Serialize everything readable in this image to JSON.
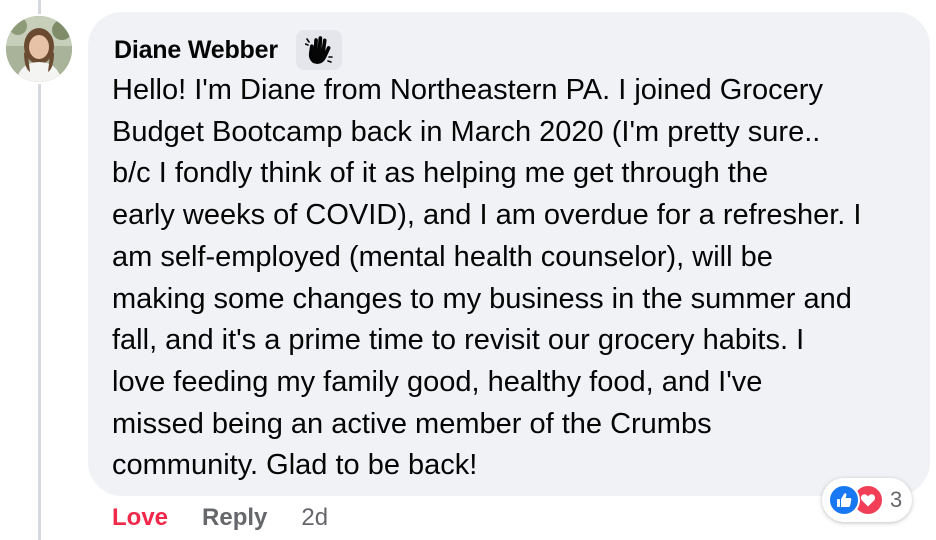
{
  "comment": {
    "author": "Diane Webber",
    "badge_icon": "wave-hand-icon",
    "text": "Hello! I'm Diane from Northeastern PA. I joined Grocery\nBudget Bootcamp back in March 2020 (I'm pretty sure..\nb/c I fondly think of it as helping me get through the\nearly weeks of COVID), and I am overdue for a refresher. I\nam self-employed (mental health counselor), will be\nmaking some changes to my business in the summer and\nfall, and it's a prime time to revisit our grocery habits. I\nlove feeding my family good, healthy food, and I've\nmissed being an active member of the Crumbs\ncommunity. Glad to be back!",
    "reactions": {
      "icons": [
        "like-icon",
        "love-icon"
      ],
      "count": "3",
      "like_color": "#1877f2",
      "love_color": "#f33e58"
    }
  },
  "actions": {
    "love_label": "Love",
    "reply_label": "Reply",
    "time": "2d",
    "love_color": "#f02849"
  }
}
